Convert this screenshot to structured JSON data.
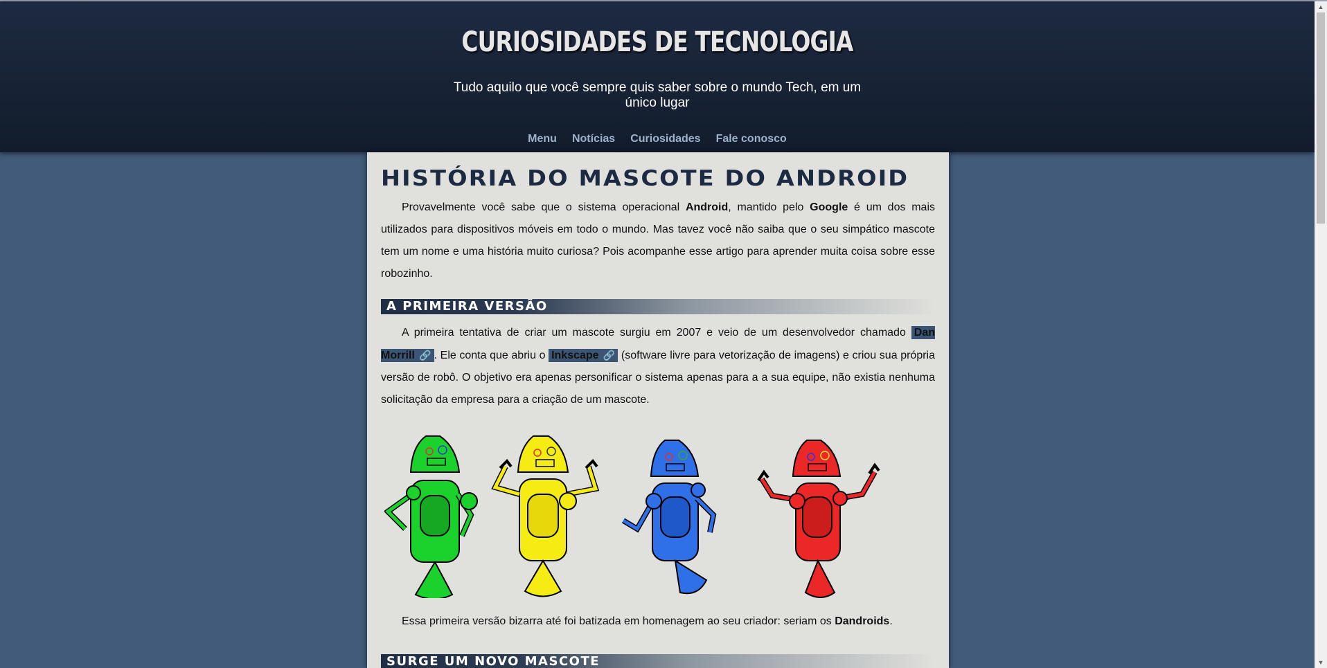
{
  "header": {
    "title": "CURIOSIDADES DE TECNOLOGIA",
    "subtitle": "Tudo aquilo que você sempre quis saber sobre o mundo Tech, em um único lugar",
    "nav": [
      "Menu",
      "Notícias",
      "Curiosidades",
      "Fale conosco"
    ]
  },
  "article": {
    "title": "HISTÓRIA DO MASCOTE DO ANDROID",
    "intro": {
      "p1": "Provavelmente você sabe que o sistema operacional ",
      "b1": "Android",
      "p2": ", mantido pelo ",
      "b2": "Google",
      "p3": " é um dos mais utilizados para dispositivos móveis em todo o mundo. Mas tavez você não saiba que o seu simpático mascote tem um nome e uma história muito curiosa? Pois acompanhe esse artigo para aprender muita coisa sobre esse robozinho."
    },
    "section1": {
      "heading": "A PRIMEIRA VERSÃO",
      "t1": "A primeira tentativa de criar um mascote surgiu em 2007 e veio de um desenvolvedor chamado ",
      "link1": "Dan Morrill",
      "t2": ". Ele conta que abriu o ",
      "link2": "Inkscape",
      "t3": " (software livre para vetorização de imagens) e criou sua própria versão de robô. O objetivo era apenas personificar o sistema apenas para a a sua equipe, não existia nenhuma solicitação da empresa para a criação de um mascote.",
      "caption1": "Essa primeira versão bizarra até foi batizada em homenagem ao seu criador: seriam os ",
      "caption_bold": "Dandroids",
      "caption2": "."
    },
    "section2": {
      "heading": "SURGE UM NOVO MASCOTE"
    },
    "link_icon": "link-icon",
    "robot_colors": [
      "#1bd12b",
      "#f4ec12",
      "#2f6fe8",
      "#ec2727"
    ]
  }
}
